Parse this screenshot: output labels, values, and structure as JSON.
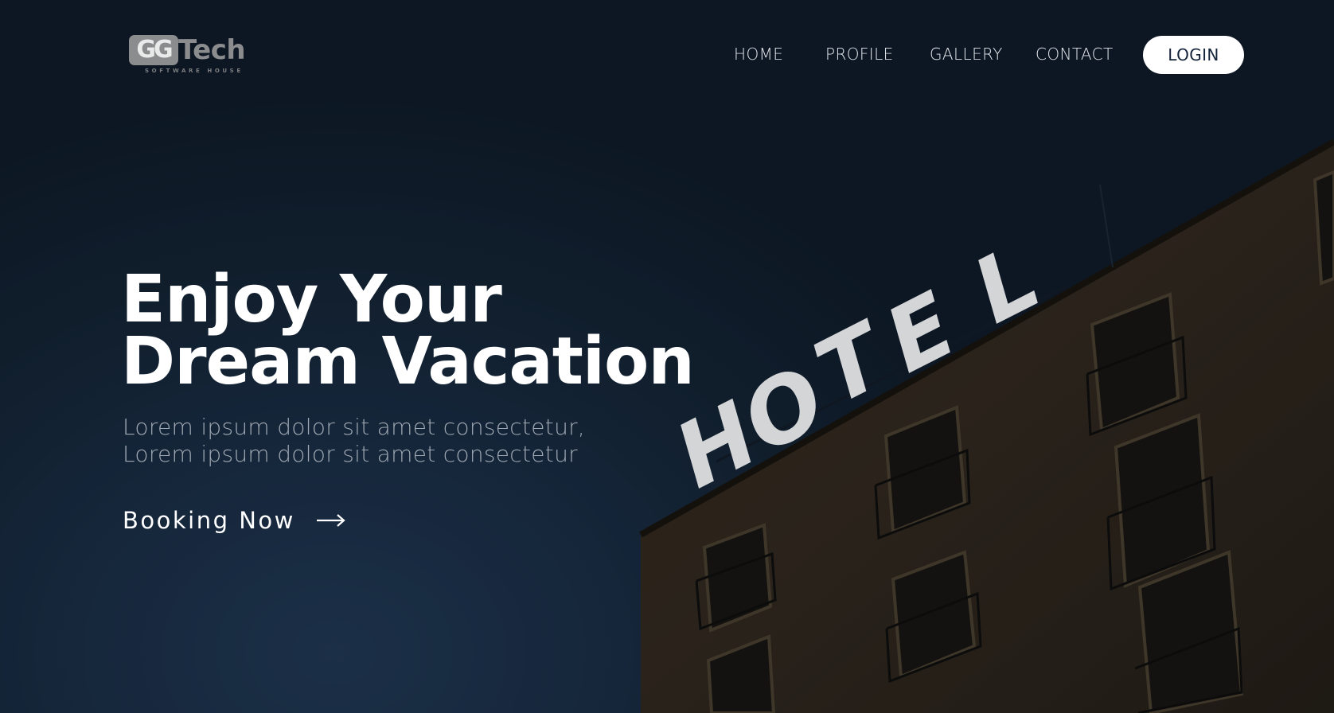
{
  "brand": {
    "mark": "GG",
    "word": "Tech",
    "tagline": "SOFTWARE HOUSE"
  },
  "nav": {
    "items": [
      {
        "label": "HOME"
      },
      {
        "label": "PROFILE"
      },
      {
        "label": "GALLERY"
      },
      {
        "label": "CONTACT"
      }
    ],
    "login_label": "LOGIN"
  },
  "hero": {
    "headline_line1": "Enjoy Your",
    "headline_line2": "Dream Vacation",
    "subtext": "Lorem ipsum dolor sit amet consectetur, Lorem ipsum dolor sit amet consectetur",
    "cta_label": "Booking Now",
    "cta_icon": "arrow-right-icon",
    "sign_text": "HOTEL"
  },
  "colors": {
    "background": "#0f1a2a",
    "building": "#2f2517",
    "accent_text": "#ffffff",
    "login_text": "#13233a"
  }
}
